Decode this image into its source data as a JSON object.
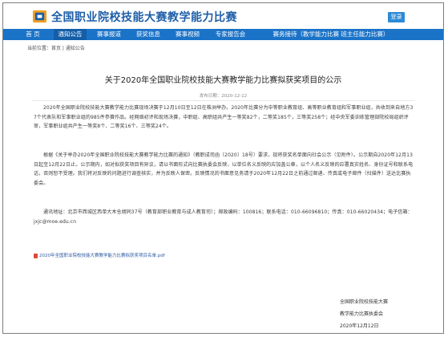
{
  "header": {
    "site_title": "全国职业院校技能大赛教学能力比赛",
    "login_label": "登录"
  },
  "nav": {
    "items": [
      {
        "label": "首 页"
      },
      {
        "label": "通知公告"
      },
      {
        "label": "赛事报道"
      },
      {
        "label": "获奖信息"
      },
      {
        "label": "赛事视频"
      },
      {
        "label": "专家报告会"
      },
      {
        "label": "赛务接待（教学能力比赛  班主任能力比赛）"
      }
    ],
    "active_index": 1
  },
  "breadcrumb": "当前位置：首页 | 通知公告",
  "article": {
    "title": "关于2020年全国职业院校技能大赛教学能力比赛拟获奖项目的公示",
    "publish": "发布日期：2020-12-12",
    "p1": "2020年全国职业院校技能大赛教学能力比赛现场决赛于12月10日至12日在株洲举办。2020年比赛分为中等职业教育组、高等职业教育组和军事职业组，共收到来自地方37个代表队和军事职业组的985件参赛作品。经网络初评和现场决赛，中职组、高职组共产生一等奖82个，二等奖185个，三等奖258个；经中央军委训练管理部院校局组织评审，军事职业组共产生一等奖8个、二等奖16个、三等奖24个。",
    "p2": "根据《关于举办2020年全国职业院校技能大赛教学能力比赛的通知》（教职成司函〔2020〕18号）要求，现将获奖名单面向社会公示（见附件）。公示期自2020年12月13日起至12月22日止。公示期内，如对拟获奖项目有异议，请以书面形式向比赛执委会反映，以单位名义反映的应加盖公章，以个人名义反映的应署真实姓名、身份证号和联系电话，否则恕不受理。我们将对反映的问题进行调查核实，并为反映人保密。反映情况的书面意见务请于2020年12月22日之前通过邮递、传真或电子邮件（扫描件）送达比赛执委会。",
    "p3": "通讯地址：北京市西城区西单大木仓胡同37号（教育部职业教育与成人教育司）；邮政编码：100816；联系电话：010-66096810；传真：010-66020434；电子信箱：jxjc@moe.edu.cn",
    "attachment": "2020年全国职业院校技能大赛教学能力比赛拟获奖项目名单.pdf",
    "signature_line1": "全国职业院校技能大赛",
    "signature_line2": "教学能力比赛执委会",
    "signature_date": "2020年12月12日"
  },
  "colors": {
    "brand": "#1f5fa8",
    "nav_bg": "#1b73c8",
    "nav_active": "#145ea8",
    "login_btn": "#2d8ad6"
  }
}
